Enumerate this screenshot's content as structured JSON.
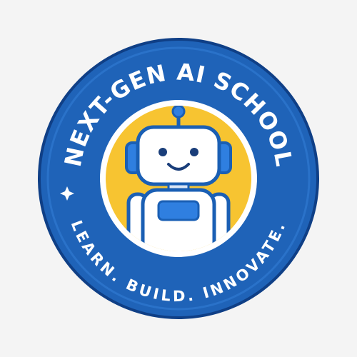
{
  "badge": {
    "top_text": "NEXT-GEN AI SCHOOL",
    "bottom_text": "LEARN. BUILD. INNOVATE.",
    "colors": {
      "background": "#f4f4f4",
      "outer_ring": "#1f63b8",
      "ring_border": "#0f3f86",
      "inner_border": "#ffffff",
      "center_fill": "#f7c431",
      "robot_body": "#ffffff",
      "robot_outline": "#1a5fb4",
      "robot_accent": "#2f7fe0",
      "robot_face": "#1a3e7a"
    },
    "icons": [
      "sparkle-icon",
      "robot-icon"
    ]
  }
}
